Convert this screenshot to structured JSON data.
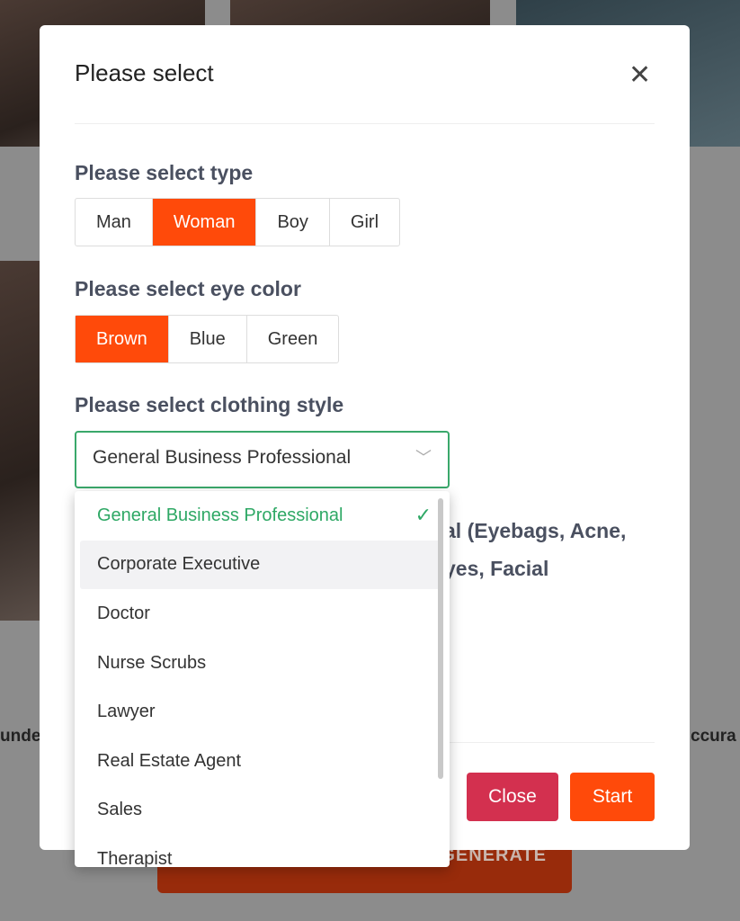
{
  "background": {
    "left_text": "unde",
    "right_text": "ccura",
    "generate_label": "GENERATE"
  },
  "modal": {
    "title": "Please select",
    "type": {
      "label": "Please select type",
      "options": [
        "Man",
        "Woman",
        "Boy",
        "Girl"
      ],
      "selected": "Woman"
    },
    "eye": {
      "label": "Please select eye color",
      "options": [
        "Brown",
        "Blue",
        "Green"
      ],
      "selected": "Brown"
    },
    "clothing": {
      "label": "Please select clothing style",
      "value": "General Business Professional",
      "options": [
        "General Business Professional",
        "Corporate Executive",
        "Doctor",
        "Nurse Scrubs",
        "Lawyer",
        "Real Estate Agent",
        "Sales",
        "Therapist"
      ],
      "hovered": "Corporate Executive"
    },
    "obscured_line1": "al (Eyebags, Acne,",
    "obscured_line2": "yes, Facial",
    "close_label": "Close",
    "start_label": "Start"
  },
  "colors": {
    "accent": "#ff4a0a",
    "success": "#2ea865",
    "close": "#d3304f"
  }
}
